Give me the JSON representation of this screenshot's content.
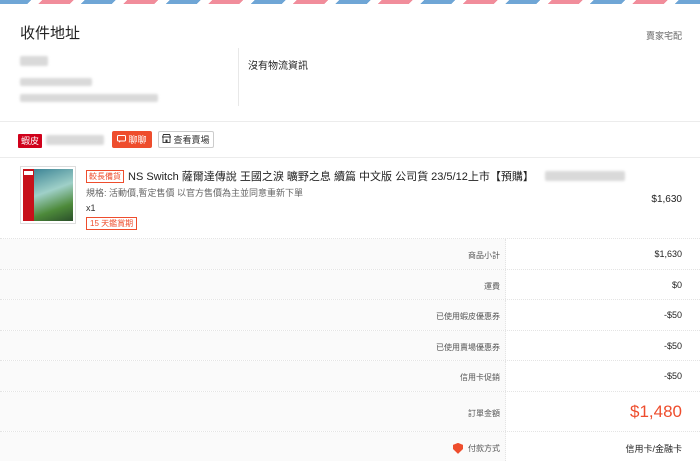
{
  "colors": {
    "accent": "#ee4d2d",
    "preferred_badge": "#d0011b",
    "stripe_blue": "#6fa6d6",
    "stripe_pink": "#f18d9b"
  },
  "address": {
    "title": "收件地址",
    "provider": "賣家宅配",
    "logistics_status": "沒有物流資訊"
  },
  "shop": {
    "badge": "蝦皮",
    "chat_label": "聊聊",
    "chat_icon": "chat-icon",
    "view_shop_label": "查看賣場",
    "view_shop_icon": "shop-icon"
  },
  "product": {
    "tag_long_prep": "較長備貨",
    "name": "NS Switch 薩爾達傳說 王國之淚 曠野之息 續篇 中文版 公司貨 23/5/12上市【預購】",
    "spec": "規格: 活動價,暫定售價 以官方售價為主並同意重新下單",
    "quantity": "x1",
    "return_tag": "15 天鑑賞期",
    "price": "$1,630"
  },
  "summary": [
    {
      "label": "商品小計",
      "value": "$1,630"
    },
    {
      "label": "運費",
      "value": "$0"
    },
    {
      "label": "已使用蝦皮優惠券",
      "value": "-$50"
    },
    {
      "label": "已使用賣場優惠券",
      "value": "-$50"
    },
    {
      "label": "信用卡促銷",
      "value": "-$50"
    }
  ],
  "total": {
    "label": "訂單金額",
    "value": "$1,480"
  },
  "payment": {
    "label": "付款方式",
    "value": "信用卡/金融卡",
    "icon": "payment-shield-icon"
  }
}
